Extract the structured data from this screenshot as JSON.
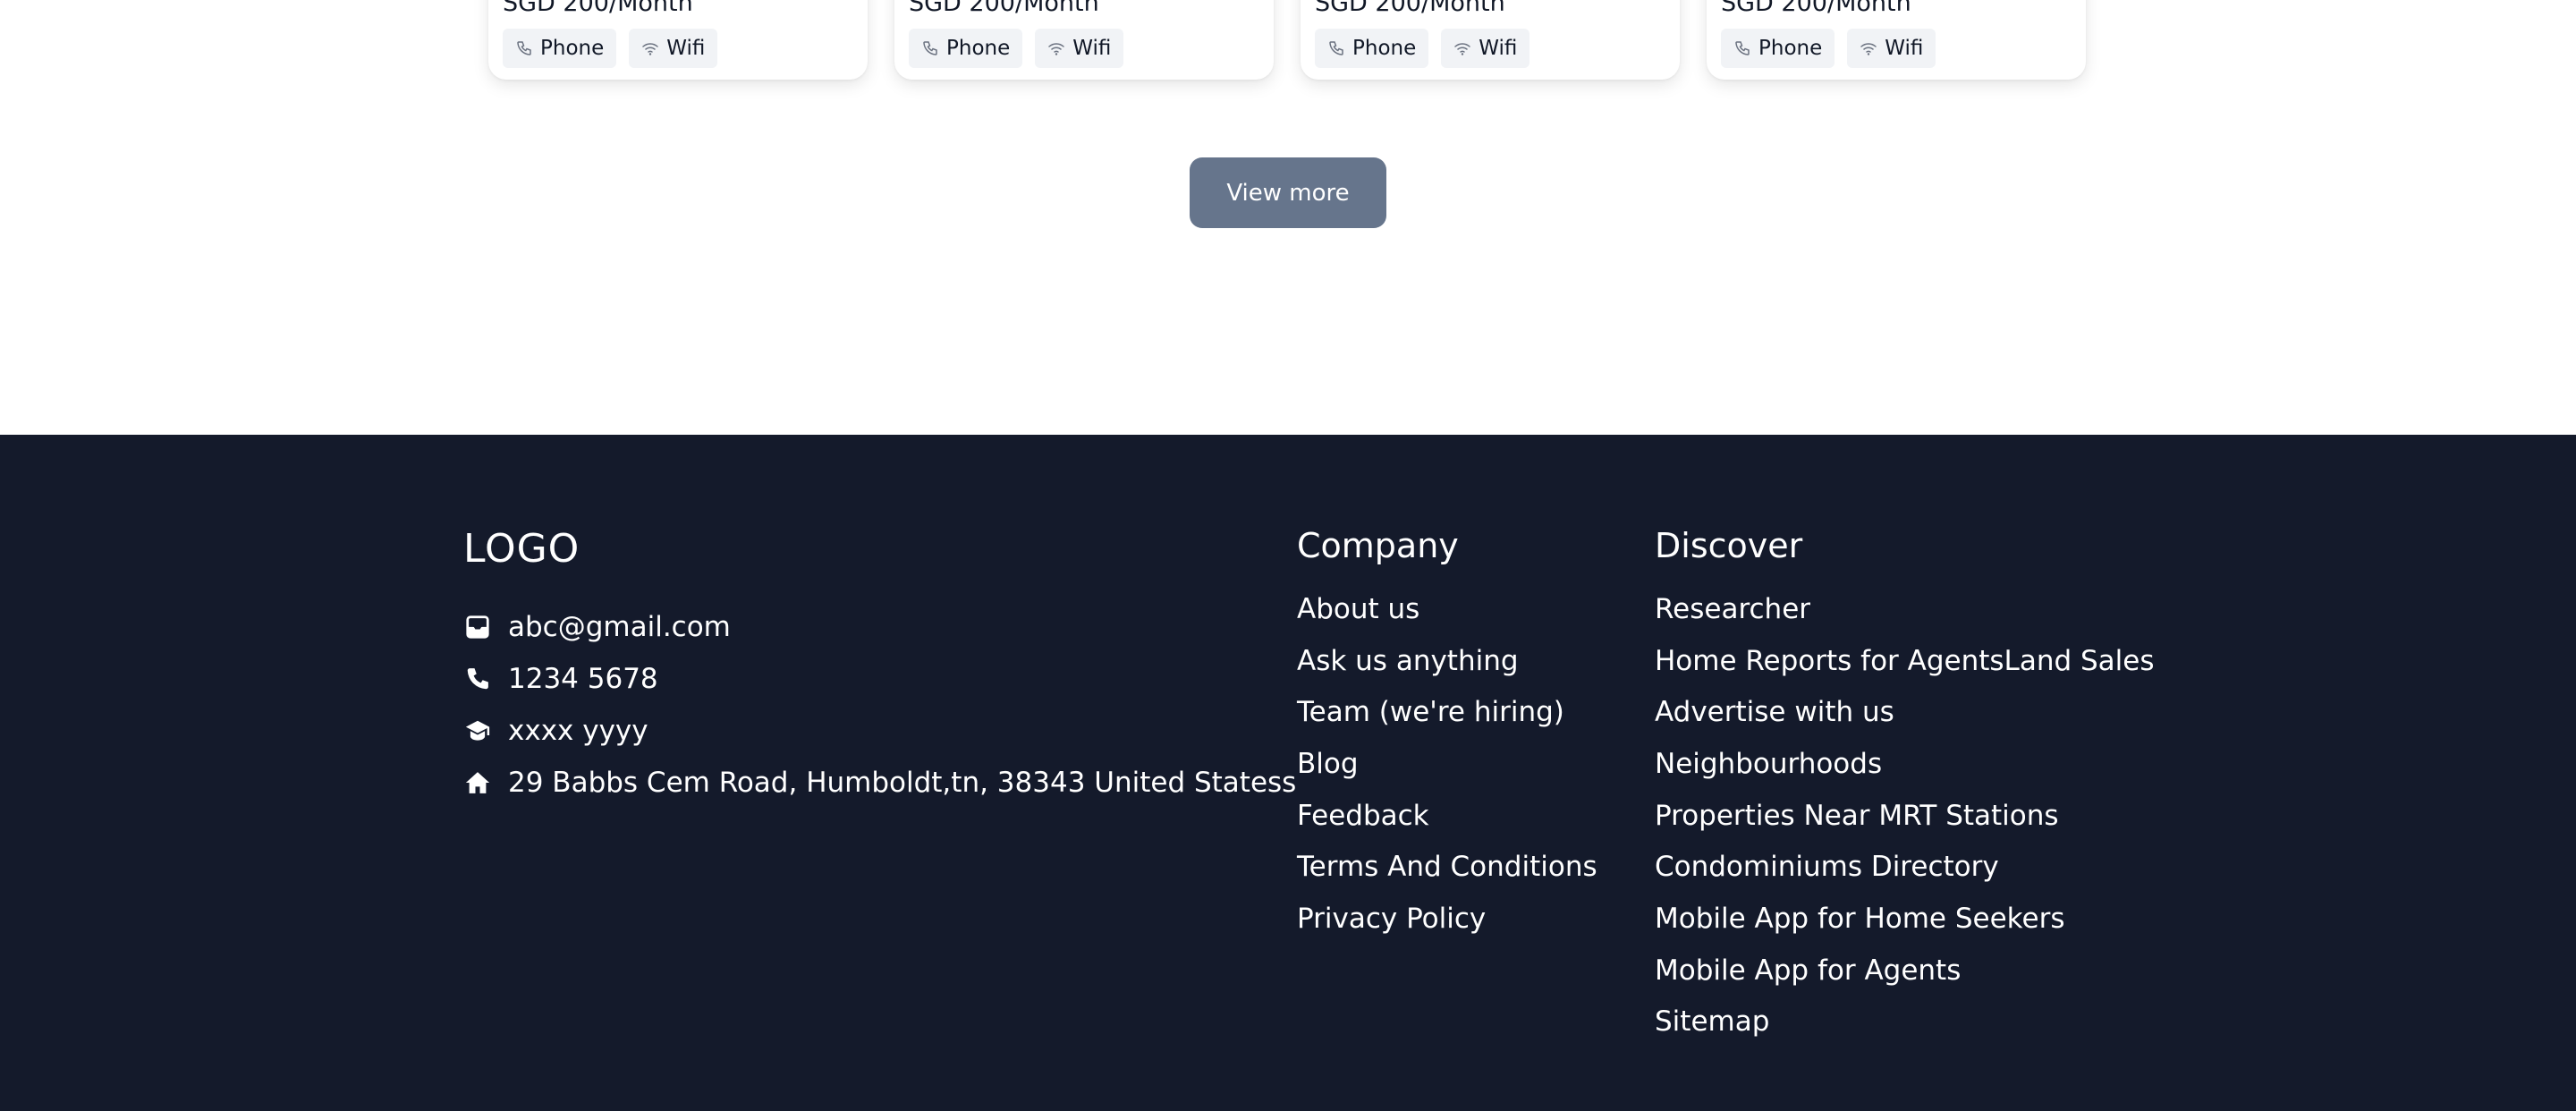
{
  "cards": [
    {
      "price": "SGD 200/Month",
      "amenities": [
        {
          "label": "Phone",
          "icon": "phone-icon"
        },
        {
          "label": "Wifi",
          "icon": "wifi-icon"
        }
      ]
    },
    {
      "price": "SGD 200/Month",
      "amenities": [
        {
          "label": "Phone",
          "icon": "phone-icon"
        },
        {
          "label": "Wifi",
          "icon": "wifi-icon"
        }
      ]
    },
    {
      "price": "SGD 200/Month",
      "amenities": [
        {
          "label": "Phone",
          "icon": "phone-icon"
        },
        {
          "label": "Wifi",
          "icon": "wifi-icon"
        }
      ]
    },
    {
      "price": "SGD 200/Month",
      "amenities": [
        {
          "label": "Phone",
          "icon": "phone-icon"
        },
        {
          "label": "Wifi",
          "icon": "wifi-icon"
        }
      ]
    }
  ],
  "view_more": {
    "label": "View more"
  },
  "footer": {
    "logo": "LOGO",
    "contacts": [
      {
        "icon": "inbox-icon",
        "text": "abc@gmail.com"
      },
      {
        "icon": "phone-icon",
        "text": "1234 5678"
      },
      {
        "icon": "graduation-cap-icon",
        "text": "xxxx yyyy"
      },
      {
        "icon": "home-icon",
        "text": "29 Babbs Cem Road, Humboldt,tn, 38343 United Statess"
      }
    ],
    "company": {
      "heading": "Company",
      "links": [
        "About us",
        "Ask us anything",
        "Team (we're hiring)",
        "Blog",
        "Feedback",
        "Terms And Conditions",
        "Privacy Policy"
      ]
    },
    "discover": {
      "heading": "Discover",
      "links": [
        "Researcher",
        "Home Reports for AgentsLand Sales",
        "Advertise with us",
        "Neighbourhoods",
        "Properties Near MRT Stations",
        "Condominiums Directory",
        "Mobile App for Home Seekers",
        "Mobile App for Agents",
        "Sitemap"
      ]
    }
  },
  "colors": {
    "footer_bg": "#141a2b",
    "button_bg": "#66758c",
    "chip_bg": "#f1f3f6"
  }
}
